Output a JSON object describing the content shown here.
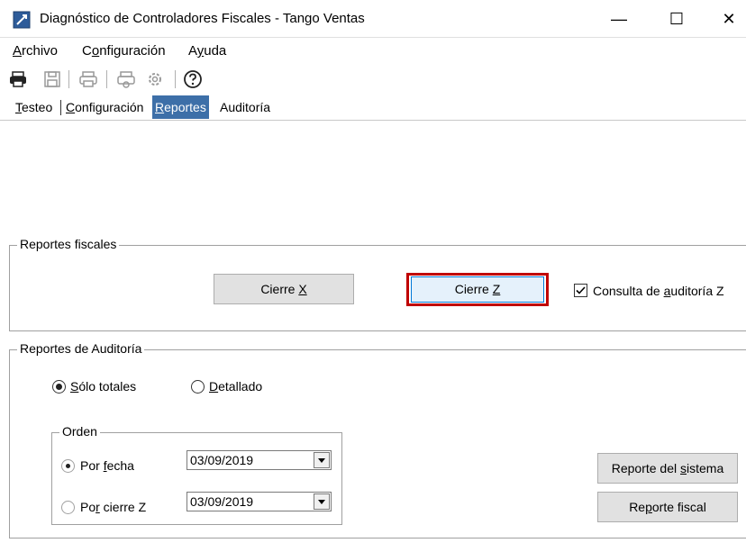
{
  "window": {
    "title": "Diagnóstico de Controladores Fiscales - Tango Ventas",
    "minimize": "—",
    "maximize": "☐",
    "close": "✕"
  },
  "menu": {
    "archivo": {
      "pre": "",
      "key": "A",
      "post": "rchivo"
    },
    "configuracion": {
      "pre": "C",
      "key": "o",
      "post": "nfiguración"
    },
    "ayuda": {
      "pre": "A",
      "key": "y",
      "post": "uda"
    }
  },
  "toolbar_icons": [
    "printer-icon",
    "save-icon",
    "print-icon",
    "print-setup-icon",
    "gear-icon",
    "help-icon"
  ],
  "tabs": {
    "testeo": {
      "key": "T",
      "post": "esteo"
    },
    "configuracion": {
      "key": "C",
      "post": "onfiguración"
    },
    "reportes": {
      "key": "R",
      "post": "eportes"
    },
    "auditoria": {
      "label": "Auditoría"
    }
  },
  "reportes_fiscales": {
    "legend": "Reportes fiscales",
    "cierre_x": {
      "pre": "Cierre ",
      "key": "X"
    },
    "cierre_z": {
      "pre": "Cierre ",
      "key": "Z"
    },
    "consulta": {
      "pre": "Consulta de ",
      "key": "a",
      "post": "uditoría Z",
      "checked": true
    }
  },
  "reportes_auditoria": {
    "legend": "Reportes de Auditoría",
    "solo_totales": {
      "pre": "",
      "key": "S",
      "post": "ólo totales",
      "selected": true
    },
    "detallado": {
      "pre": "",
      "key": "D",
      "post": "etallado",
      "selected": false
    },
    "orden": {
      "legend": "Orden",
      "por_fecha": {
        "pre": "Por ",
        "key": "f",
        "post": "echa",
        "value": "03/09/2019",
        "selected": true
      },
      "por_cierre": {
        "pre": "Po",
        "key": "r",
        "post": " cierre Z",
        "value": "03/09/2019",
        "selected": false
      }
    },
    "reporte_sistema": {
      "pre": "Reporte del ",
      "key": "s",
      "post": "istema"
    },
    "reporte_fiscal": {
      "pre": "Re",
      "key": "p",
      "post": "orte fiscal"
    }
  },
  "colors": {
    "active_tab": "#3d6fa8",
    "focus_ring": "#c00000"
  }
}
